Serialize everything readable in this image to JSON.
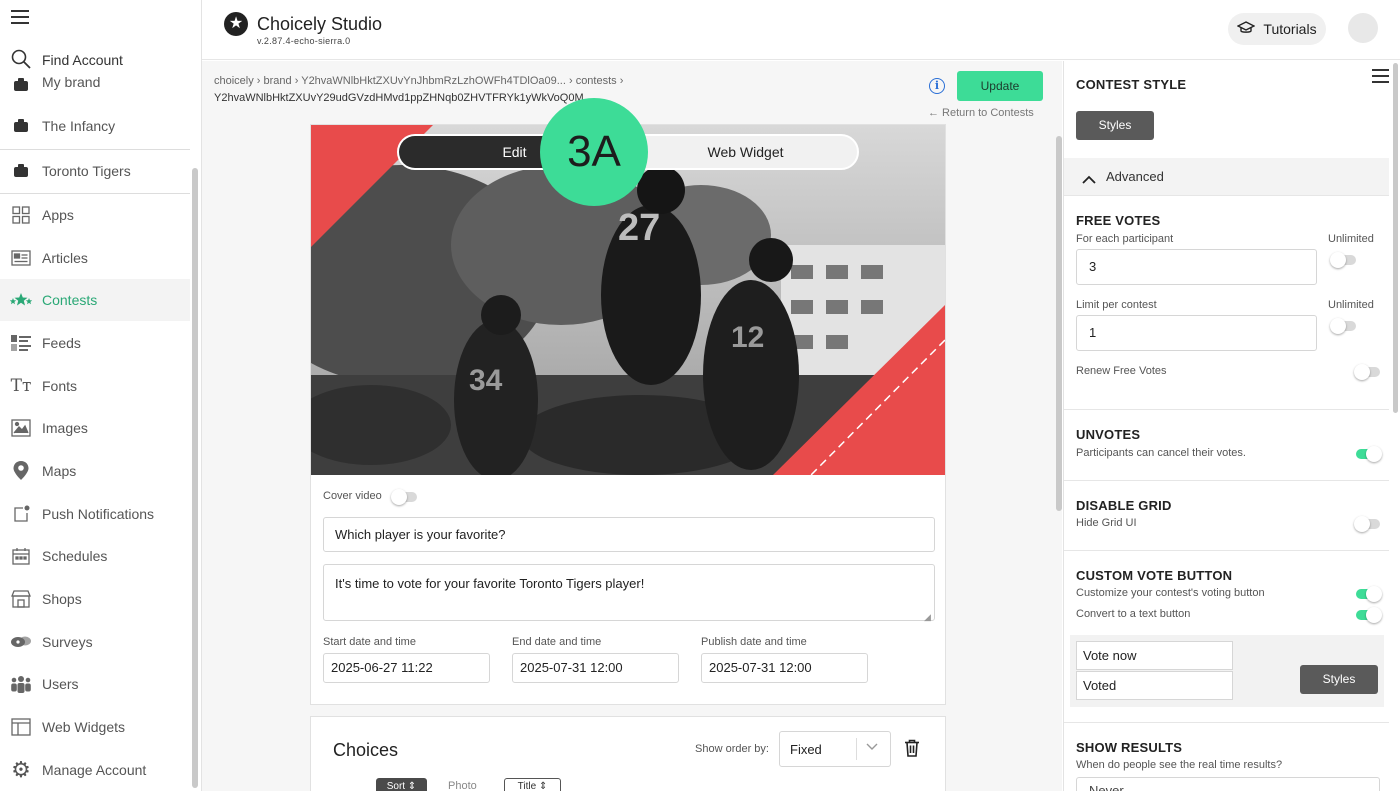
{
  "header": {
    "app_title": "Choicely Studio",
    "version": "v.2.87.4-echo-sierra.0",
    "tutorials_label": "Tutorials"
  },
  "sidebar": {
    "find_account": "Find Account",
    "partial_item": "My brand",
    "items": [
      {
        "label": "The Infancy",
        "icon": "brand-icon"
      },
      {
        "label": "Toronto Tigers",
        "icon": "brand-icon"
      },
      {
        "label": "Apps",
        "icon": "apps-grid-icon"
      },
      {
        "label": "Articles",
        "icon": "articles-icon"
      },
      {
        "label": "Contests",
        "icon": "contests-icon",
        "active": true
      },
      {
        "label": "Feeds",
        "icon": "feeds-icon"
      },
      {
        "label": "Fonts",
        "icon": "fonts-icon"
      },
      {
        "label": "Images",
        "icon": "images-icon"
      },
      {
        "label": "Maps",
        "icon": "map-pin-icon"
      },
      {
        "label": "Push Notifications",
        "icon": "push-notification-icon"
      },
      {
        "label": "Schedules",
        "icon": "calendar-icon"
      },
      {
        "label": "Shops",
        "icon": "shop-icon"
      },
      {
        "label": "Surveys",
        "icon": "surveys-icon"
      },
      {
        "label": "Users",
        "icon": "users-icon"
      },
      {
        "label": "Web Widgets",
        "icon": "web-widgets-icon"
      },
      {
        "label": "Manage Account",
        "icon": "gear-icon"
      }
    ]
  },
  "breadcrumb": {
    "line1": "choicely › brand › Y2hvaWNlbHktZXUvYnJhbmRzLzhOWFh4TDlOa09... › contests ›",
    "line2": "Y2hvaWNlbHktZXUvY29udGVzdHMvd1ppZHNqb0ZHVTFRYk1yWkVoQ0M"
  },
  "actions": {
    "update_label": "Update",
    "return_label": "← Return to Contests"
  },
  "editor": {
    "tabs": [
      "Edit",
      "Web Widget"
    ],
    "step_badge": "3A",
    "cover_video_label": "Cover video",
    "question": "Which player is your favorite?",
    "description": "It's time to vote for your favorite Toronto Tigers player!",
    "start_label": "Start date and time",
    "start_value": "2025-06-27 11:22",
    "end_label": "End date and time",
    "end_value": "2025-07-31 12:00",
    "publish_label": "Publish date and time",
    "publish_value": "2025-07-31 12:00"
  },
  "choices": {
    "title": "Choices",
    "show_order_label": "Show order by:",
    "order_value": "Fixed",
    "sort_label": "Sort",
    "photo_label": "Photo",
    "title_label": "Title"
  },
  "right_panel": {
    "contest_style_title": "CONTEST STYLE",
    "styles_label": "Styles",
    "advanced_label": "Advanced",
    "free_votes_title": "FREE VOTES",
    "each_participant_label": "For each participant",
    "each_participant_value": "3",
    "limit_label": "Limit per contest",
    "limit_value": "1",
    "unlimited_label": "Unlimited",
    "renew_label": "Renew Free Votes",
    "unvotes_title": "UNVOTES",
    "unvotes_desc": "Participants can cancel their votes.",
    "disable_grid_title": "DISABLE GRID",
    "disable_grid_desc": "Hide Grid UI",
    "custom_vote_title": "CUSTOM VOTE BUTTON",
    "customize_label": "Customize your contest's voting button",
    "convert_label": "Convert to a text button",
    "vote_now_value": "Vote now",
    "voted_value": "Voted",
    "show_results_title": "SHOW RESULTS",
    "show_results_desc": "When do people see the real time results?",
    "results_value": "Never"
  },
  "toggles": {
    "cover_video": false,
    "unlimited_each": false,
    "unlimited_limit": false,
    "renew_free_votes": false,
    "unvotes": true,
    "disable_grid": false,
    "customize_vote_button": true,
    "convert_text_button": true
  },
  "colors": {
    "accent": "#3ddc97",
    "active_nav": "#2aa876",
    "cover_stripe": "#e84b4b"
  }
}
